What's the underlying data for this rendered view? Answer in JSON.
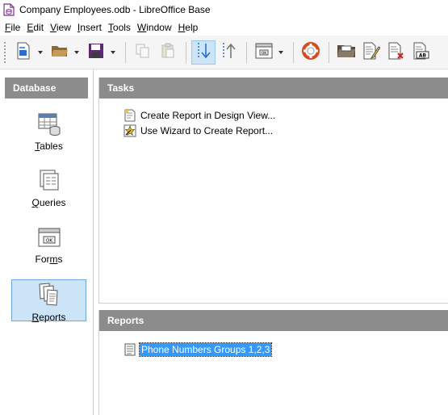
{
  "window": {
    "title": "Company Employees.odb - LibreOffice Base"
  },
  "menu": [
    {
      "label": "File",
      "mnemonic": "F"
    },
    {
      "label": "Edit",
      "mnemonic": "E"
    },
    {
      "label": "View",
      "mnemonic": "V"
    },
    {
      "label": "Insert",
      "mnemonic": "I"
    },
    {
      "label": "Tools",
      "mnemonic": "T"
    },
    {
      "label": "Window",
      "mnemonic": "W"
    },
    {
      "label": "Help",
      "mnemonic": "H"
    }
  ],
  "toolbar_icons": [
    "new-icon",
    "open-icon",
    "save-icon",
    "copy-icon",
    "paste-icon",
    "sort-ascending-icon",
    "sort-descending-icon",
    "form-icon",
    "help-lifebuoy-icon",
    "folder-icon",
    "edit-document-icon",
    "delete-document-icon",
    "rename-icon"
  ],
  "left_panel": {
    "header": "Database",
    "items": [
      {
        "label": "Tables",
        "mnemonic": "T",
        "icon": "tables-icon",
        "selected": false
      },
      {
        "label": "Queries",
        "mnemonic": "Q",
        "icon": "queries-icon",
        "selected": false
      },
      {
        "label": "Forms",
        "mnemonic": "m",
        "icon": "forms-icon",
        "selected": false
      },
      {
        "label": "Reports",
        "mnemonic": "R",
        "icon": "reports-icon",
        "selected": true
      }
    ]
  },
  "tasks": {
    "header": "Tasks",
    "items": [
      {
        "label": "Create Report in Design View...",
        "icon": "design-view-icon"
      },
      {
        "label": "Use Wizard to Create Report...",
        "icon": "wizard-icon"
      }
    ]
  },
  "reports": {
    "header": "Reports",
    "items": [
      {
        "label": "Phone Numbers Groups 1,2,3",
        "icon": "report-document-icon",
        "selected": true
      }
    ]
  },
  "colors": {
    "header_bg": "#8c8c8c",
    "selection_bg": "#cce4f7",
    "item_selected": "#3399ff"
  }
}
